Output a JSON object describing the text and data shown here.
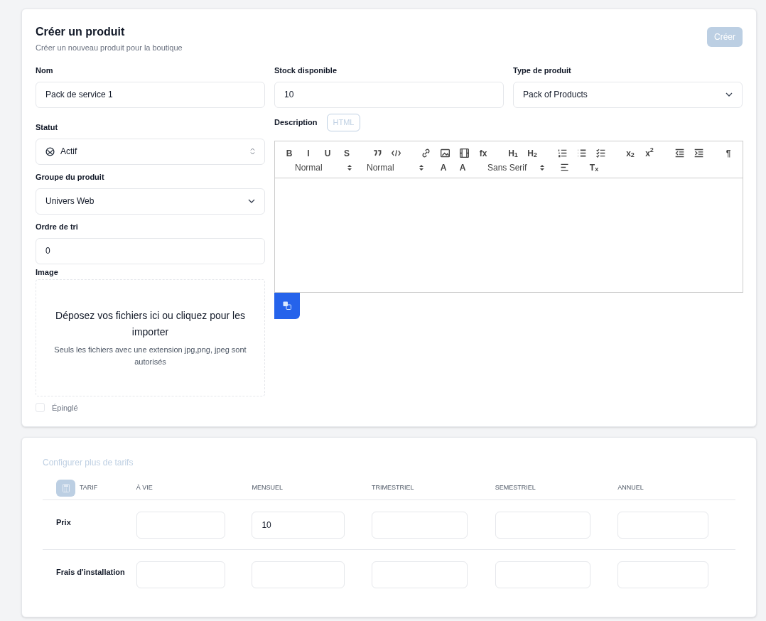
{
  "header": {
    "title": "Créer un produit",
    "subtitle": "Créer un nouveau produit pour la boutique",
    "create_button": {
      "label": "Créer",
      "disabled": true
    }
  },
  "fields": {
    "name": {
      "label": "Nom",
      "value": "Pack de service 1"
    },
    "stock": {
      "label": "Stock disponible",
      "value": "10"
    },
    "type": {
      "label": "Type de produit",
      "value": "Pack of Products"
    },
    "status": {
      "label": "Statut",
      "value": "Actif"
    },
    "group": {
      "label": "Groupe du produit",
      "value": "Univers Web"
    },
    "sort_order": {
      "label": "Ordre de tri",
      "value": "0"
    }
  },
  "image": {
    "label": "Image",
    "title": "Déposez vos fichiers ici ou cliquez pour les importer",
    "hint": "Seuls les fichiers avec une extension jpg,png, jpeg sont autorisés"
  },
  "pinned": {
    "label": "Épinglé",
    "checked": false
  },
  "description": {
    "label": "Description",
    "html_button": {
      "label": "HTML",
      "selected": false
    },
    "toolbar": [
      {
        "kind": "glyph",
        "text": "B"
      },
      {
        "kind": "glyph",
        "text": "I"
      },
      {
        "kind": "glyph",
        "text": "U"
      },
      {
        "kind": "glyph",
        "text": "S"
      },
      {
        "kind": "gap"
      },
      {
        "kind": "icon"
      },
      {
        "kind": "icon"
      },
      {
        "kind": "gap"
      },
      {
        "kind": "icon"
      },
      {
        "kind": "icon"
      },
      {
        "kind": "icon"
      },
      {
        "kind": "glyph",
        "text": "fx"
      },
      {
        "kind": "gap"
      },
      {
        "kind": "glyph",
        "text": "H$_{1}$"
      },
      {
        "kind": "glyph",
        "text": "H$_{2}$"
      },
      {
        "kind": "gap"
      },
      {
        "kind": "icon"
      },
      {
        "kind": "icon"
      },
      {
        "kind": "icon"
      },
      {
        "kind": "gap"
      },
      {
        "kind": "glyph",
        "text": "x$_{2}$"
      },
      {
        "kind": "glyph",
        "text": "x$^{2}$"
      },
      {
        "kind": "gap"
      },
      {
        "kind": "icon"
      },
      {
        "kind": "icon"
      },
      {
        "kind": "gap"
      },
      {
        "kind": "glyph",
        "text": "¶"
      },
      {
        "kind": "gap"
      },
      {
        "kind": "picker",
        "text": "Normal"
      },
      {
        "kind": "picker",
        "text": "Normal"
      },
      {
        "kind": "glyph",
        "text": "A"
      },
      {
        "kind": "glyph",
        "text": "A"
      },
      {
        "kind": "gap"
      },
      {
        "kind": "picker",
        "text": "Sans Serif"
      },
      {
        "kind": "icon"
      },
      {
        "kind": "gap"
      },
      {
        "kind": "glyph",
        "text": "T$_{x}$"
      }
    ]
  },
  "pricing": {
    "title": "Configurer plus de tarifs",
    "columns": [
      {
        "label": "TARIF"
      },
      {
        "label": "À VIE"
      },
      {
        "label": "MENSUEL"
      },
      {
        "label": "TRIMESTRIEL"
      },
      {
        "label": "SEMESTRIEL"
      },
      {
        "label": "ANNUEL"
      }
    ],
    "rows": [
      {
        "label": "Prix",
        "values": {
          "monthly": "10"
        }
      },
      {
        "label": "Frais d'installation"
      }
    ]
  }
}
